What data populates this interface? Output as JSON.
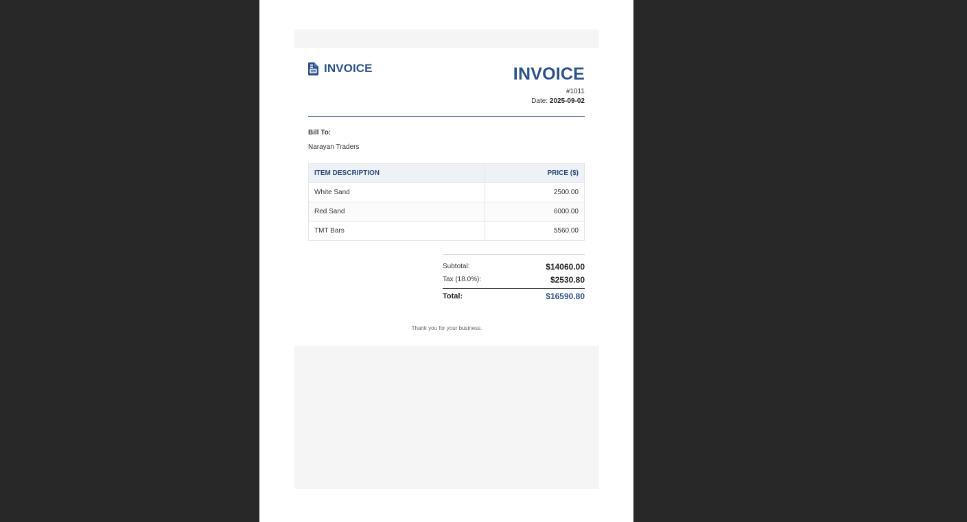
{
  "brand": {
    "icon": "document-icon",
    "label": "INVOICE"
  },
  "invoice": {
    "title": "INVOICE",
    "number": "#1011",
    "date_label": "Date:",
    "date_value": "2025-09-02"
  },
  "bill_to": {
    "label": "Bill To:",
    "name": "Narayan Traders"
  },
  "items_table": {
    "headers": {
      "description": "ITEM DESCRIPTION",
      "price": "PRICE ($)"
    },
    "rows": [
      {
        "description": "White Sand",
        "price": "2500.00"
      },
      {
        "description": "Red Sand",
        "price": "6000.00"
      },
      {
        "description": "TMT Bars",
        "price": "5560.00"
      }
    ]
  },
  "totals": {
    "subtotal_label": "Subtotal:",
    "subtotal_value": "$14060.00",
    "tax_label": "Tax (18.0%):",
    "tax_value": "$2530.80",
    "total_label": "Total:",
    "total_value": "$16590.80"
  },
  "footer": {
    "thanks": "Thank you for your business."
  },
  "colors": {
    "accent": "#2c5189",
    "viewer_bg": "#282828",
    "canvas_bg": "#f5f5f5"
  }
}
